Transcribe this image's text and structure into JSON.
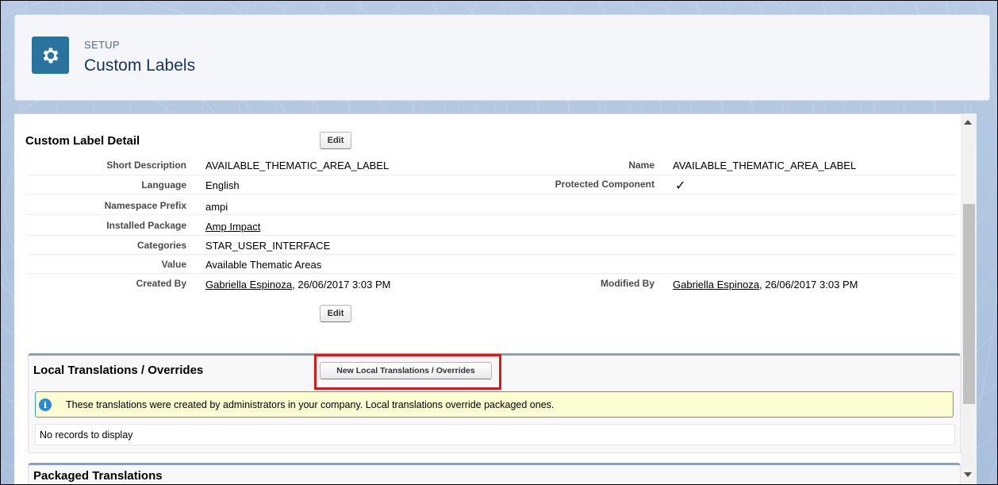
{
  "header": {
    "eyebrow": "SETUP",
    "title": "Custom Labels",
    "icon": "gear-icon"
  },
  "detail": {
    "title": "Custom Label Detail",
    "edit_label": "Edit",
    "fields": {
      "short_description": {
        "label": "Short Description",
        "value": "AVAILABLE_THEMATIC_AREA_LABEL"
      },
      "name": {
        "label": "Name",
        "value": "AVAILABLE_THEMATIC_AREA_LABEL"
      },
      "language": {
        "label": "Language",
        "value": "English"
      },
      "protected_component": {
        "label": "Protected Component",
        "value": "✓"
      },
      "namespace_prefix": {
        "label": "Namespace Prefix",
        "value": "ampi"
      },
      "installed_package": {
        "label": "Installed Package",
        "value": "Amp Impact"
      },
      "categories": {
        "label": "Categories",
        "value": "STAR_USER_INTERFACE"
      },
      "value": {
        "label": "Value",
        "value": "Available Thematic Areas"
      },
      "created_by": {
        "label": "Created By",
        "user": "Gabriella Espinoza",
        "date": ", 26/06/2017 3:03 PM"
      },
      "modified_by": {
        "label": "Modified By",
        "user": "Gabriella Espinoza",
        "date": ", 26/06/2017 3:03 PM"
      }
    }
  },
  "local_translations": {
    "title": "Local Translations / Overrides",
    "new_button": "New Local Translations / Overrides",
    "info": "These translations were created by administrators in your company. Local translations override packaged ones.",
    "empty": "No records to display"
  },
  "packaged_translations": {
    "title": "Packaged Translations"
  },
  "colors": {
    "header_icon_bg": "#2a739e",
    "highlight": "#e0151b",
    "info_border": "#38a5d6",
    "info_bg": "#fdfdd2"
  }
}
